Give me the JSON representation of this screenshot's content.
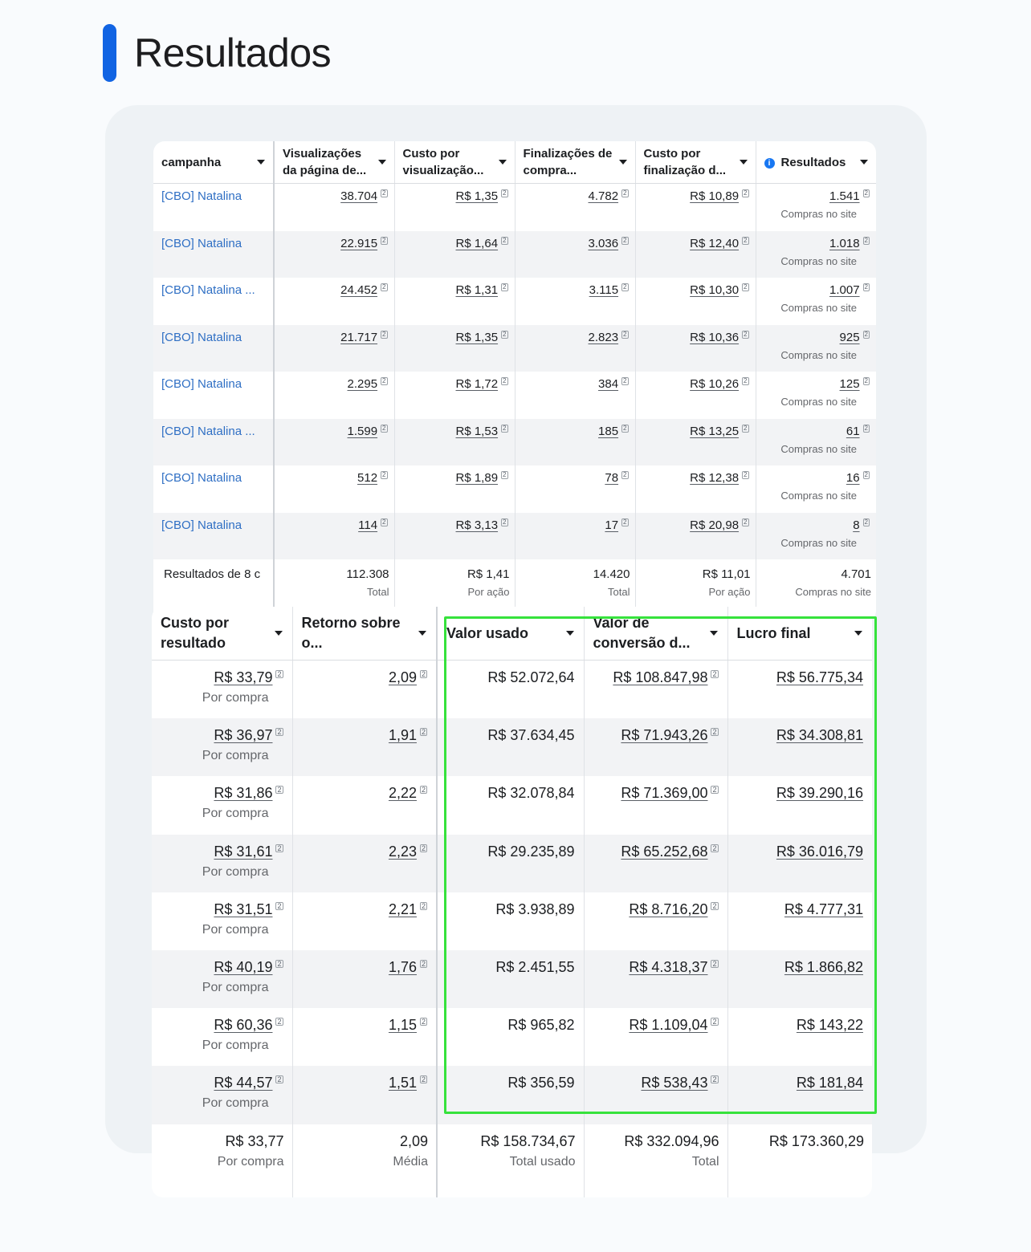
{
  "section": {
    "title": "Resultados"
  },
  "colors": {
    "accent": "#1264e3",
    "link": "#2f6fc4",
    "highlight": "#36e23c"
  },
  "table1": {
    "headers": [
      "campanha",
      "Visualizações da página de...",
      "Custo por visualização...",
      "Finalizações de compra...",
      "Custo por finalização d...",
      "Resultados"
    ],
    "result_sub": "Compras no site",
    "rows": [
      {
        "campaign": "[CBO] Natalina",
        "views": "38.704",
        "cost_view": "R$ 1,35",
        "checkouts": "4.782",
        "cost_checkout": "R$ 10,89",
        "results": "1.541"
      },
      {
        "campaign": "[CBO] Natalina",
        "views": "22.915",
        "cost_view": "R$ 1,64",
        "checkouts": "3.036",
        "cost_checkout": "R$ 12,40",
        "results": "1.018"
      },
      {
        "campaign": "[CBO] Natalina ...",
        "views": "24.452",
        "cost_view": "R$ 1,31",
        "checkouts": "3.115",
        "cost_checkout": "R$ 10,30",
        "results": "1.007"
      },
      {
        "campaign": "[CBO] Natalina",
        "views": "21.717",
        "cost_view": "R$ 1,35",
        "checkouts": "2.823",
        "cost_checkout": "R$ 10,36",
        "results": "925"
      },
      {
        "campaign": "[CBO] Natalina",
        "views": "2.295",
        "cost_view": "R$ 1,72",
        "checkouts": "384",
        "cost_checkout": "R$ 10,26",
        "results": "125"
      },
      {
        "campaign": "[CBO] Natalina ...",
        "views": "1.599",
        "cost_view": "R$ 1,53",
        "checkouts": "185",
        "cost_checkout": "R$ 13,25",
        "results": "61"
      },
      {
        "campaign": "[CBO] Natalina",
        "views": "512",
        "cost_view": "R$ 1,89",
        "checkouts": "78",
        "cost_checkout": "R$ 12,38",
        "results": "16"
      },
      {
        "campaign": "[CBO] Natalina",
        "views": "114",
        "cost_view": "R$ 3,13",
        "checkouts": "17",
        "cost_checkout": "R$ 20,98",
        "results": "8"
      }
    ],
    "total": {
      "label": "Resultados de 8 c",
      "views": "112.308",
      "views_sub": "Total",
      "cost_view": "R$ 1,41",
      "cost_view_sub": "Por ação",
      "checkouts": "14.420",
      "checkouts_sub": "Total",
      "cost_checkout": "R$ 11,01",
      "cost_checkout_sub": "Por ação",
      "results": "4.701",
      "results_sub": "Compras no site"
    }
  },
  "table2": {
    "headers": [
      "Custo por resultado",
      "Retorno sobre o...",
      "Valor usado",
      "Valor de conversão d...",
      "Lucro final"
    ],
    "cost_sub": "Por compra",
    "rows": [
      {
        "cost": "R$ 33,79",
        "roas": "2,09",
        "spent": "R$ 52.072,64",
        "conv": "R$ 108.847,98",
        "profit": "R$ 56.775,34"
      },
      {
        "cost": "R$ 36,97",
        "roas": "1,91",
        "spent": "R$ 37.634,45",
        "conv": "R$ 71.943,26",
        "profit": "R$ 34.308,81"
      },
      {
        "cost": "R$ 31,86",
        "roas": "2,22",
        "spent": "R$ 32.078,84",
        "conv": "R$ 71.369,00",
        "profit": "R$ 39.290,16"
      },
      {
        "cost": "R$ 31,61",
        "roas": "2,23",
        "spent": "R$ 29.235,89",
        "conv": "R$ 65.252,68",
        "profit": "R$ 36.016,79"
      },
      {
        "cost": "R$ 31,51",
        "roas": "2,21",
        "spent": "R$ 3.938,89",
        "conv": "R$ 8.716,20",
        "profit": "R$ 4.777,31"
      },
      {
        "cost": "R$ 40,19",
        "roas": "1,76",
        "spent": "R$ 2.451,55",
        "conv": "R$ 4.318,37",
        "profit": "R$ 1.866,82"
      },
      {
        "cost": "R$ 60,36",
        "roas": "1,15",
        "spent": "R$ 965,82",
        "conv": "R$ 1.109,04",
        "profit": "R$ 143,22"
      },
      {
        "cost": "R$ 44,57",
        "roas": "1,51",
        "spent": "R$ 356,59",
        "conv": "R$ 538,43",
        "profit": "R$ 181,84"
      }
    ],
    "total": {
      "cost": "R$ 33,77",
      "cost_sub": "Por compra",
      "roas": "2,09",
      "roas_sub": "Média",
      "spent": "R$ 158.734,67",
      "spent_sub": "Total usado",
      "conv": "R$ 332.094,96",
      "conv_sub": "Total",
      "profit": "R$ 173.360,29"
    }
  }
}
